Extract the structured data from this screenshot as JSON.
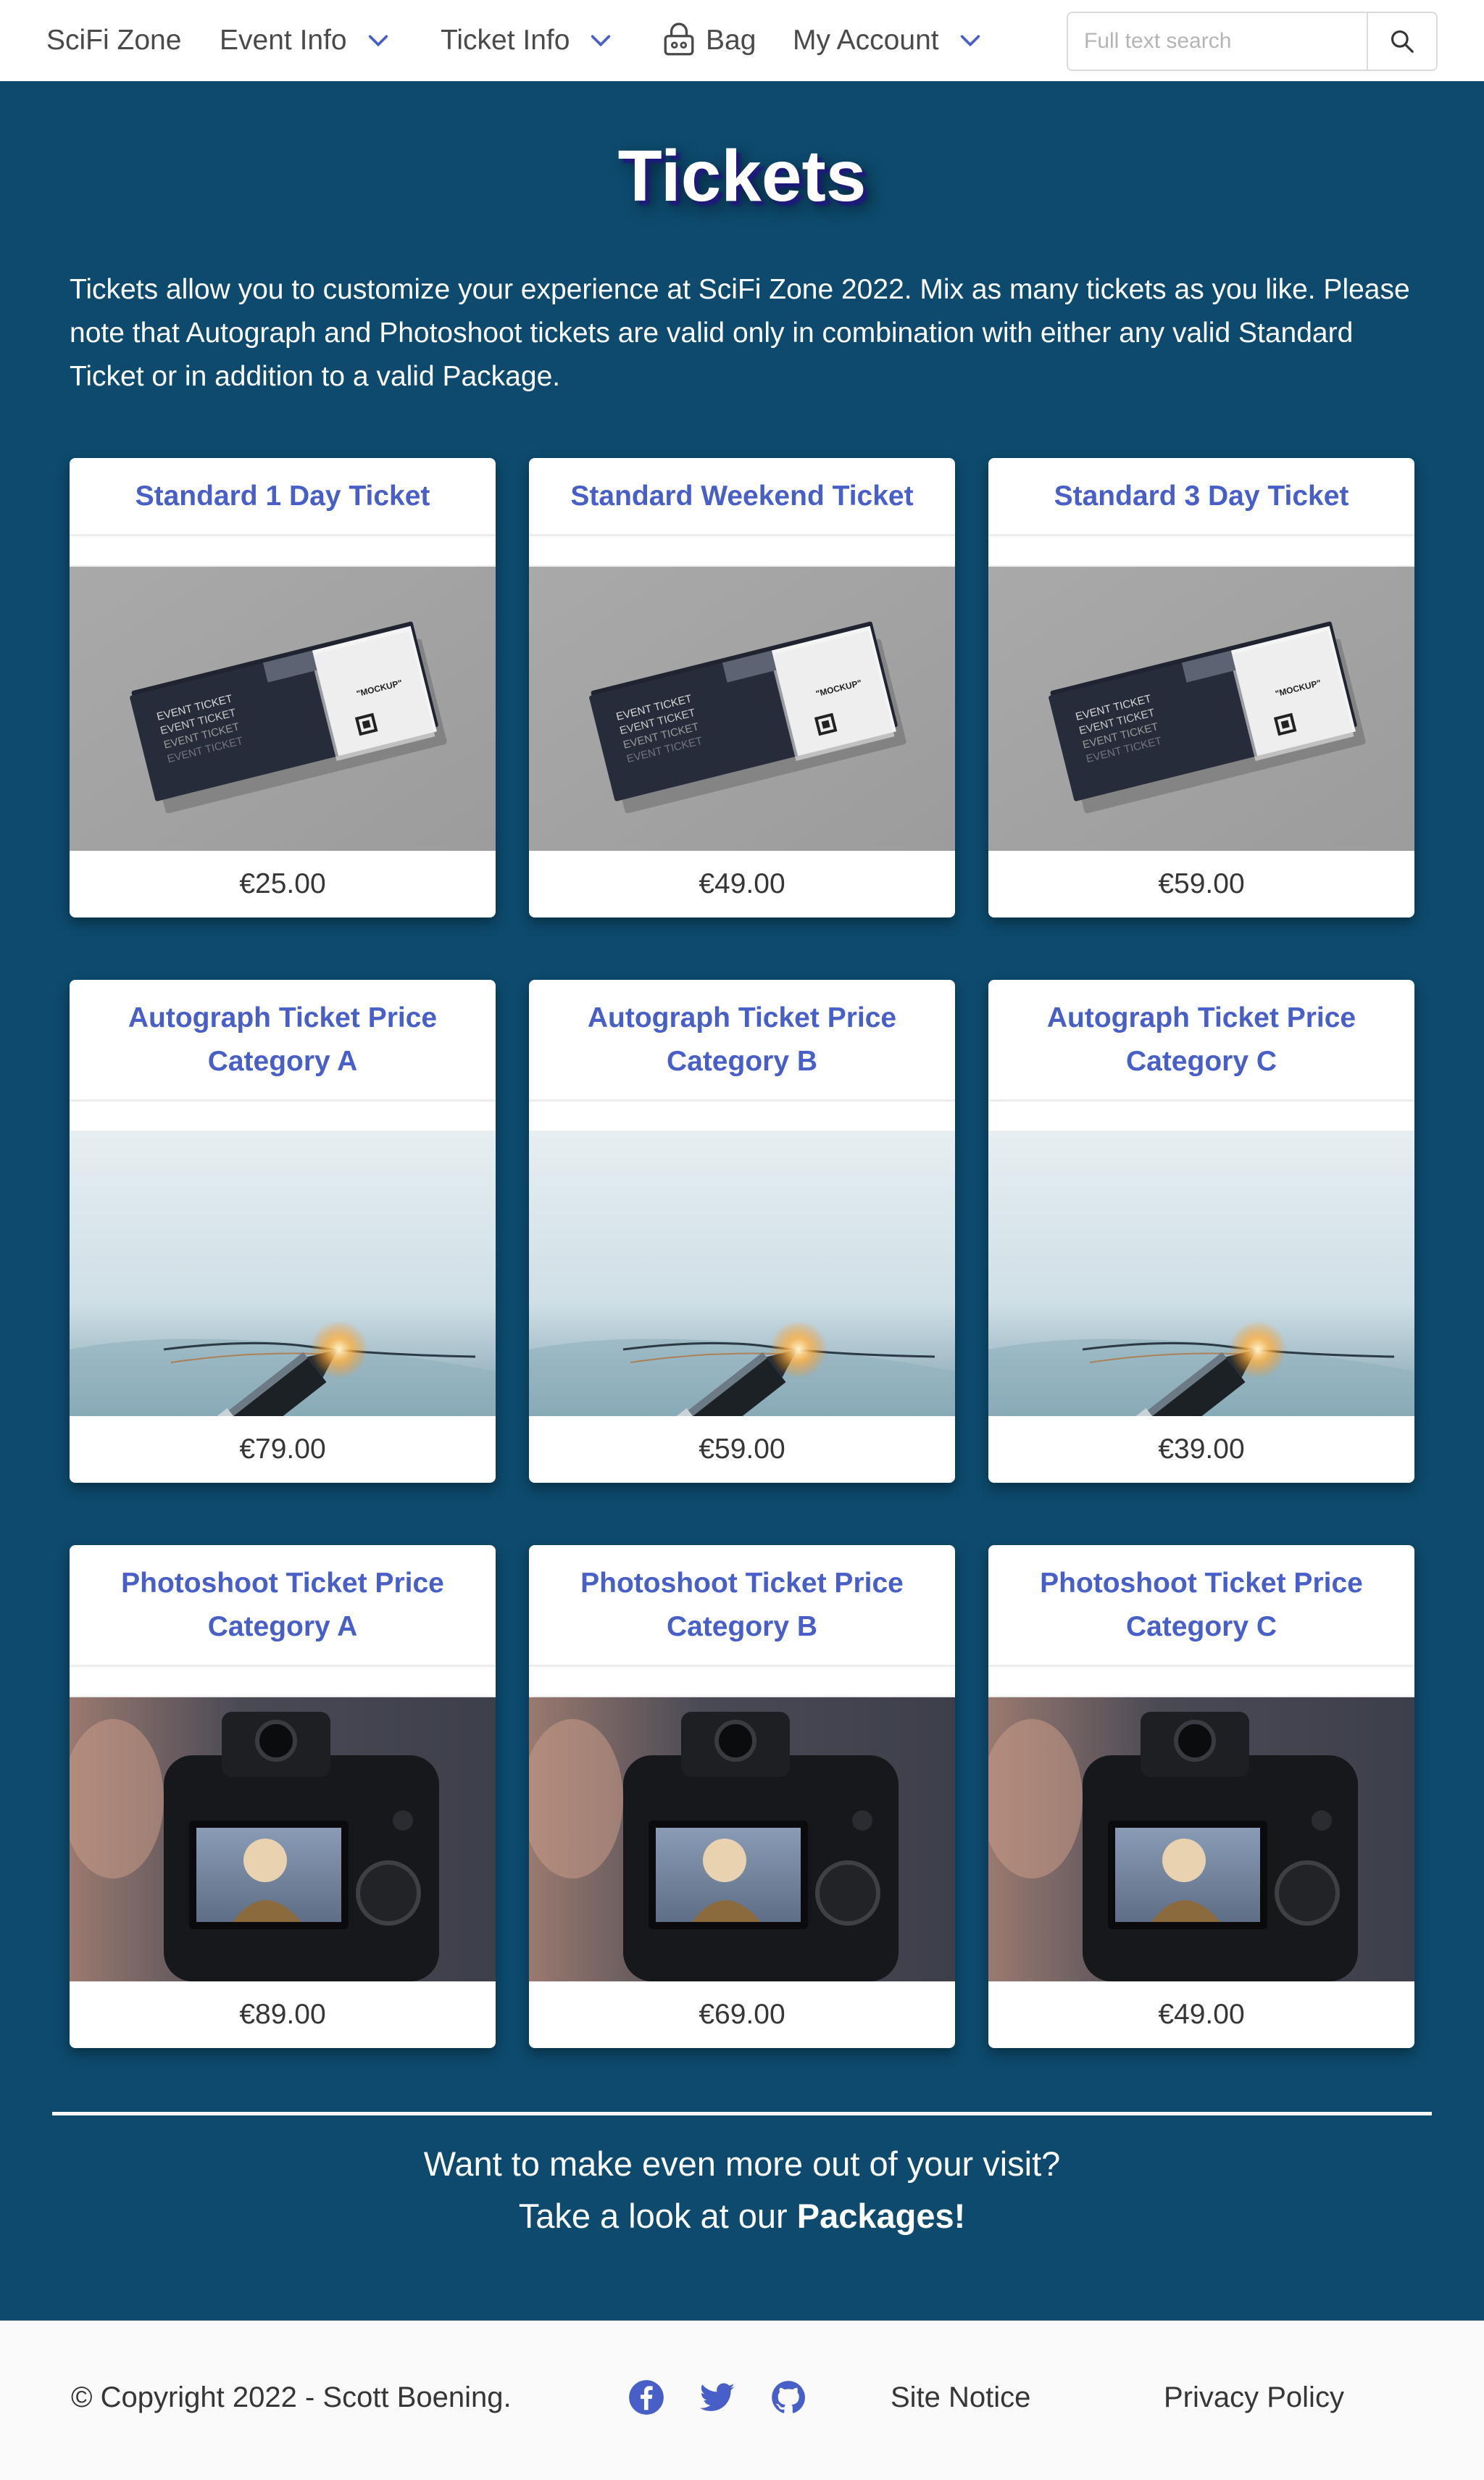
{
  "navbar": {
    "brand": "SciFi Zone",
    "event_info": "Event Info",
    "ticket_info": "Ticket Info",
    "bag": "Bag",
    "my_account": "My Account",
    "search_placeholder": "Full text search"
  },
  "page": {
    "title": "Tickets",
    "intro": "Tickets allow you to customize your experience at SciFi Zone 2022. Mix as many tickets as you like. Please note that Autograph and Photoshoot tickets are valid only in combination with either any valid Standard Ticket or in addition to a valid Package."
  },
  "tickets": [
    {
      "title": "Standard 1 Day Ticket",
      "price": "€25.00",
      "image": "event-ticket-mockup"
    },
    {
      "title": "Standard Weekend Ticket",
      "price": "€49.00",
      "image": "event-ticket-mockup"
    },
    {
      "title": "Standard 3 Day Ticket",
      "price": "€59.00",
      "image": "event-ticket-mockup"
    },
    {
      "title": "Autograph Ticket Price Category A",
      "price": "€79.00",
      "image": "fountain-pen-signing"
    },
    {
      "title": "Autograph Ticket Price Category B",
      "price": "€59.00",
      "image": "fountain-pen-signing"
    },
    {
      "title": "Autograph Ticket Price Category C",
      "price": "€39.00",
      "image": "fountain-pen-signing"
    },
    {
      "title": "Photoshoot Ticket Price Category A",
      "price": "€89.00",
      "image": "camera-photoshoot"
    },
    {
      "title": "Photoshoot Ticket Price Category B",
      "price": "€69.00",
      "image": "camera-photoshoot"
    },
    {
      "title": "Photoshoot Ticket Price Category C",
      "price": "€49.00",
      "image": "camera-photoshoot"
    }
  ],
  "cta": {
    "line1": "Want to make even more out of your visit?",
    "line2_prefix": "Take a look at our ",
    "link": "Packages!"
  },
  "footer": {
    "copyright": "© Copyright 2022 - Scott Boening.",
    "social": [
      "facebook-icon",
      "twitter-icon",
      "github-icon"
    ],
    "site_notice": "Site Notice",
    "privacy_policy": "Privacy Policy"
  },
  "colors": {
    "background": "#0d4a6d",
    "accent": "#485fc7",
    "card": "#ffffff",
    "footer": "#fafafa"
  }
}
